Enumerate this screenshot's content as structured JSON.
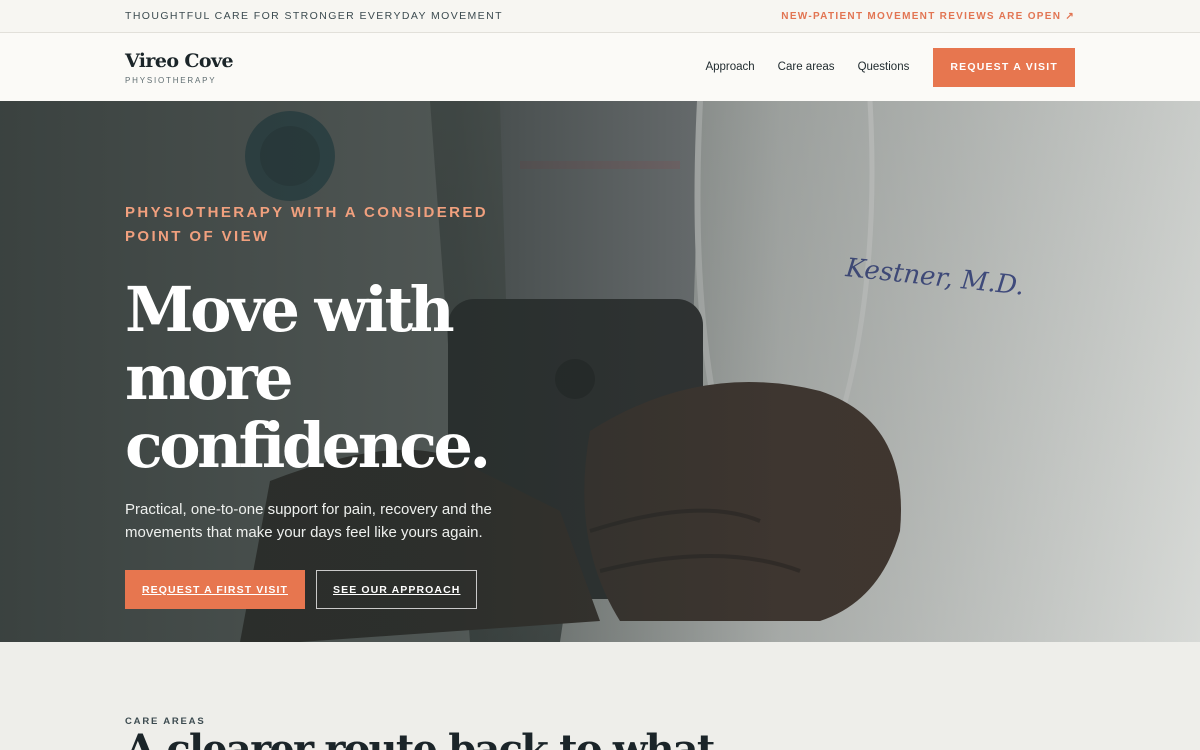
{
  "topbar": {
    "tagline": "THOUGHTFUL CARE FOR STRONGER EVERYDAY MOVEMENT",
    "notice": "NEW-PATIENT MOVEMENT REVIEWS ARE OPEN ↗"
  },
  "header": {
    "brand_name": "Vireo Cove",
    "brand_sub": "PHYSIOTHERAPY",
    "nav": [
      "Approach",
      "Care areas",
      "Questions"
    ],
    "cta": "REQUEST A VISIT"
  },
  "hero": {
    "eyebrow": "PHYSIOTHERAPY WITH A CONSIDERED POINT OF VIEW",
    "headline": "Move with more confidence.",
    "lede": "Practical, one-to-one support for pain, recovery and the movements that make your days feel like yours again.",
    "primary_cta": "REQUEST A FIRST VISIT",
    "secondary_cta": "SEE OUR APPROACH",
    "photo_lettering": "Kestner, M.D."
  },
  "care_areas": {
    "label": "CARE AREAS",
    "title": "A clearer route back to what"
  },
  "colors": {
    "accent": "#e7764f",
    "eyebrow": "#f1a07e",
    "ink": "#1b2529"
  }
}
